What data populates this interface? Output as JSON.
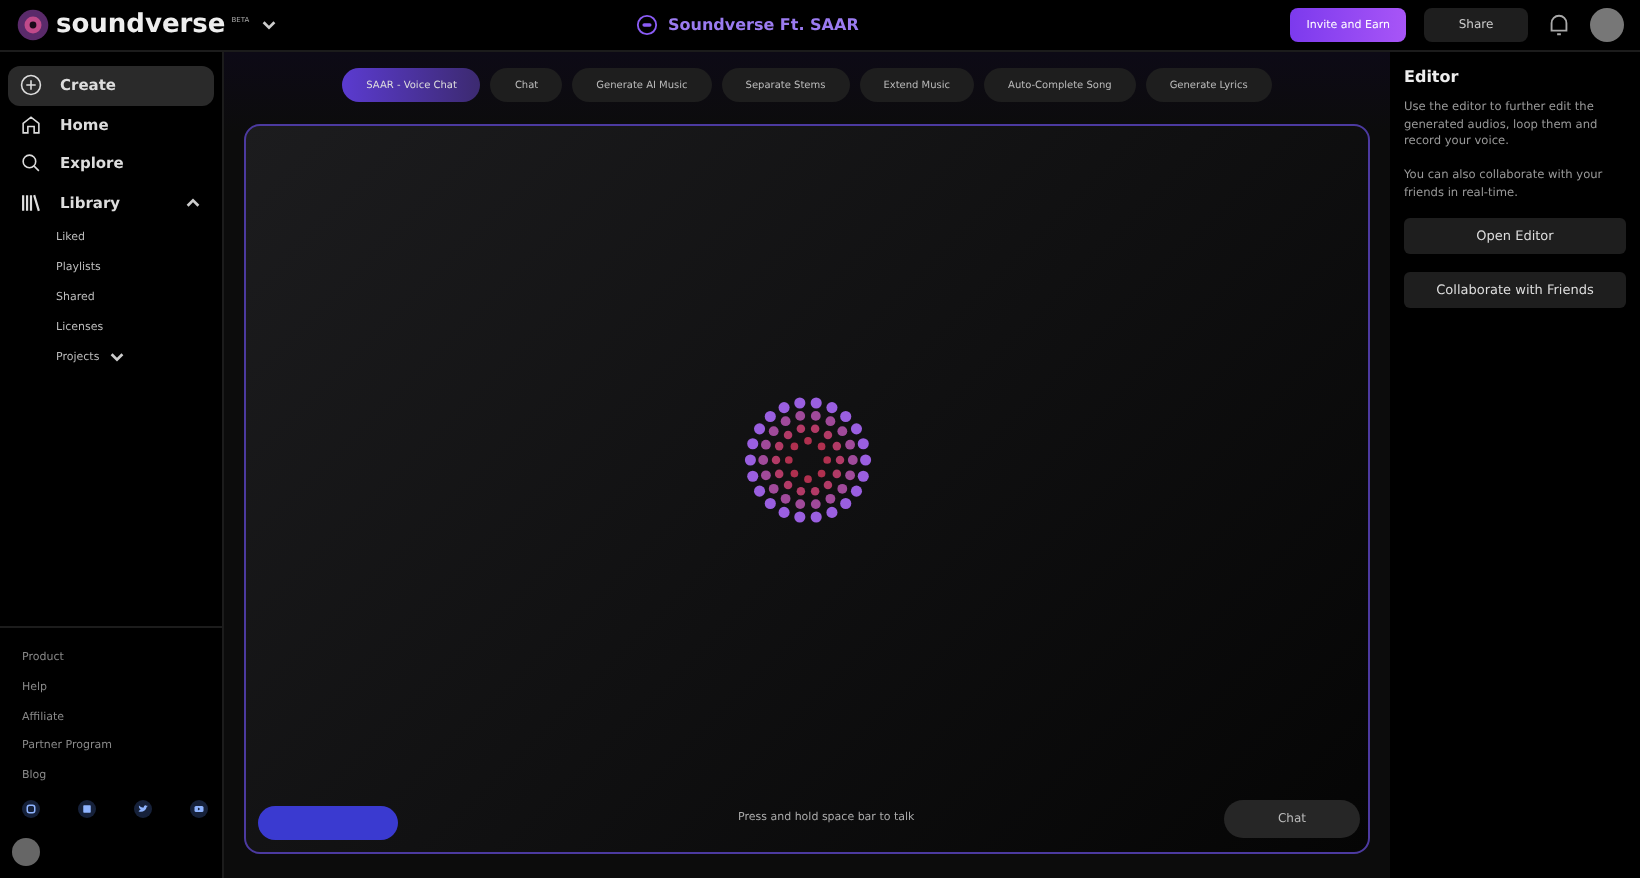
{
  "header": {
    "logo_text": "soundverse",
    "beta": "BETA",
    "center_title": "Soundverse Ft. SAAR",
    "invite_button": "Invite and Earn",
    "share_button": "Share"
  },
  "sidebar": {
    "primary": [
      {
        "label": "Create",
        "selected": true
      },
      {
        "label": "Home",
        "selected": false
      },
      {
        "label": "Explore",
        "selected": false
      },
      {
        "label": "Library",
        "selected": false
      }
    ],
    "library_expanded": true,
    "library_items": [
      "Liked",
      "Playlists",
      "Shared",
      "Licenses"
    ],
    "projects": {
      "label": "Projects",
      "expanded": false
    },
    "footer_links": [
      "Product",
      "Help",
      "Affiliate",
      "Partner Program",
      "Blog"
    ]
  },
  "tabs": [
    {
      "label": "SAAR - Voice Chat",
      "selected": true
    },
    {
      "label": "Chat",
      "selected": false
    },
    {
      "label": "Generate AI Music",
      "selected": false
    },
    {
      "label": "Separate Stems",
      "selected": false
    },
    {
      "label": "Extend Music",
      "selected": false
    },
    {
      "label": "Auto-Complete Song",
      "selected": false
    },
    {
      "label": "Generate Lyrics",
      "selected": false
    }
  ],
  "voice_chat": {
    "hint": "Press and hold space bar to talk",
    "chat_button": "Chat"
  },
  "editor_panel": {
    "title": "Editor",
    "paragraphs": [
      "Use the editor to further edit the generated audios, loop them and record your voice.",
      "You can also collaborate with your friends in real-time."
    ],
    "buttons": [
      "Open Editor",
      "Collaborate with Friends"
    ]
  }
}
